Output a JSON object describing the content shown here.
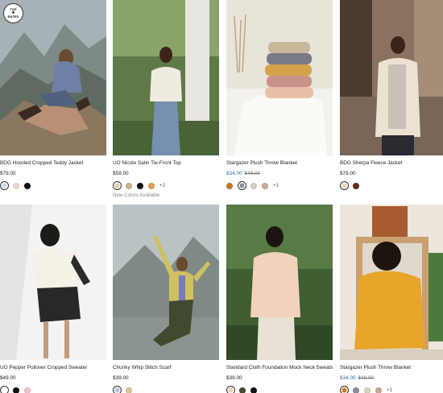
{
  "products": [
    {
      "name": "BDG Hooded Cropped Teddy Jacket",
      "price": "$79.00",
      "swatches": [
        "#c8d6e8",
        "#f1d7d2",
        "#111111"
      ],
      "selected_swatch": 0,
      "badge": {
        "line1": "TOP",
        "line2": "RATED",
        "icon": "star-icon"
      }
    },
    {
      "name": "UO Nicole Satin Tie-Front Top",
      "price": "$59.00",
      "swatches": [
        "#d8c9b0",
        "#c9b28a",
        "#111111",
        "#e0a050"
      ],
      "selected_swatch": 0,
      "more": "+2",
      "note": "New Colors Available"
    },
    {
      "name": "Stargazer Plush Throw Blanket",
      "sale_price": "$34.00",
      "original_price": "$49.00",
      "swatches": [
        "#c8781e",
        "#8c8ca0",
        "#d8d0c4",
        "#c9a89a"
      ],
      "selected_swatch": 1,
      "more": "+1"
    },
    {
      "name": "BDG Sherpa Fleece Jacket",
      "price": "$79.00",
      "swatches": [
        "#e6d7c3",
        "#6a2a1a"
      ],
      "selected_swatch": 0
    },
    {
      "name": "UO Pepper Pullover Cropped Sweater",
      "price": "$49.00",
      "swatches": [
        "#ffffff",
        "#111111",
        "#f2c4cc"
      ],
      "selected_swatch": 0
    },
    {
      "name": "Chunky Whip Stitch Scarf",
      "price": "$39.00",
      "swatches": [
        "#b8c4e0",
        "#d8c89a"
      ],
      "selected_swatch": 0
    },
    {
      "name": "Standard Cloth Foundation Mock Neck Sweatshirt",
      "price": "$39.00",
      "swatches": [
        "#f2ccb4",
        "#4a4a30",
        "#111111"
      ],
      "selected_swatch": 0
    },
    {
      "name": "Stargazer Plush Throw Blanket",
      "sale_price": "$34.00",
      "original_price": "$49.00",
      "swatches": [
        "#c8781e",
        "#8c8ca0",
        "#d8d0c4",
        "#c9a89a"
      ],
      "selected_swatch": 0,
      "more": "+1"
    }
  ],
  "colors": {
    "sale": "#2b6cb0",
    "text": "#222222"
  }
}
